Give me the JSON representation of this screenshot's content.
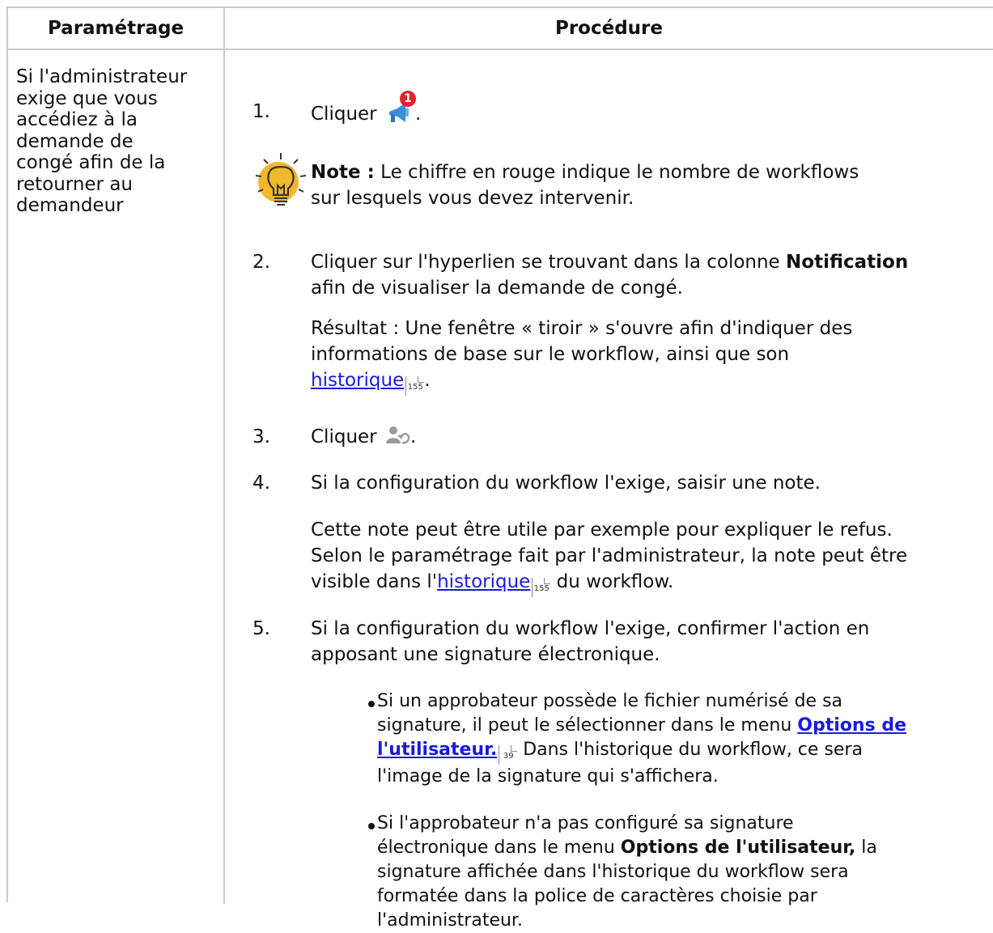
{
  "table": {
    "header_left": "Paramétrage",
    "header_right": "Procédure"
  },
  "param": {
    "lines": [
      "Si l'administrateur",
      "exige que vous",
      "accédiez à la",
      "demande de",
      "congé afin de la",
      "retourner au",
      "demandeur"
    ]
  },
  "step1": {
    "num": "1.",
    "text_before": "Cliquer",
    "text_after": "."
  },
  "notification_icon": {
    "badge": "1"
  },
  "note": {
    "label": "Note :",
    "line1": "Le chiffre en rouge indique le nombre de workflows",
    "line2": "sur lesquels vous devez intervenir."
  },
  "step2": {
    "num": "2.",
    "line1_before": "Cliquer sur l'hyperlien se trouvant dans la colonne",
    "line1_bold": "Notification",
    "line2": "afin de visualiser la demande de congé.",
    "result_line1": "Résultat  : Une fenêtre «  tiroir  » s'ouvre afin d'indiquer des",
    "result_line2": "informations de base sur le workflow, ainsi que son",
    "result_link": "historique",
    "result_ref": "155",
    "result_end": "."
  },
  "step3": {
    "num": "3.",
    "text_before": "Cliquer",
    "text_after": "."
  },
  "step4": {
    "num": "4.",
    "line1": "Si la configuration du workflow l'exige, saisir une note.",
    "p_line1": "Cette note peut être utile par exemple pour expliquer le refus.",
    "p_line2": "Selon le paramétrage fait par l'administrateur, la note peut être",
    "p_line3_before": "visible dans l'",
    "p_line3_link": "historique",
    "p_line3_ref": "155",
    "p_line3_after": " du workflow."
  },
  "step5": {
    "num": "5.",
    "line1": "Si la configuration du workflow l'exige, confirmer l'action en",
    "line2": "apposant une signature électronique.",
    "b1_line1": "Si un approbateur possède le fichier numérisé de sa",
    "b1_line2_before": "signature, il peut le sélectionner dans le menu ",
    "b1_line2_link": "Options de",
    "b1_line3_link": "l'utilisateur.",
    "b1_line3_ref": "39",
    "b1_line3_after": " Dans l'historique du workflow, ce sera",
    "b1_line4": "l'image de la signature qui s'affichera.",
    "b2_line1": "Si l'approbateur n'a pas configuré sa signature",
    "b2_line2_before": "électronique dans le menu ",
    "b2_line2_bold": "Options de l'utilisateur,",
    "b2_line2_after": " la",
    "b2_line3": "signature affichée dans l'historique du workflow sera",
    "b2_line4": "formatée dans la police de caractères choisie par",
    "b2_line5": "l'administrateur."
  },
  "icons": {
    "notification": "megaphone-notification-icon",
    "return": "user-return-icon",
    "note": "lightbulb-note-icon"
  },
  "colors": {
    "link": "#1a1adf",
    "badge": "#e0242a",
    "bulb": "#f0b72f",
    "border": "#c9c9c9"
  }
}
